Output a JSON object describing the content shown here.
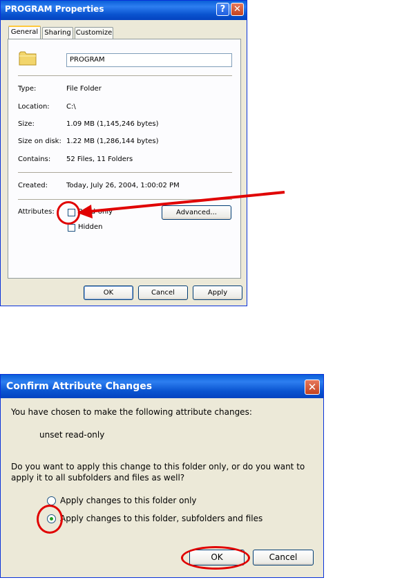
{
  "properties_dialog": {
    "title": "PROGRAM Properties",
    "help_button": "?",
    "close_button": "✕",
    "tabs": [
      "General",
      "Sharing",
      "Customize"
    ],
    "name_value": "PROGRAM",
    "fields": [
      {
        "label": "Type:",
        "value": "File Folder"
      },
      {
        "label": "Location:",
        "value": "C:\\"
      },
      {
        "label": "Size:",
        "value": "1.09 MB (1,145,246 bytes)"
      },
      {
        "label": "Size on disk:",
        "value": "1.22 MB (1,286,144 bytes)"
      },
      {
        "label": "Contains:",
        "value": "52 Files, 11 Folders"
      }
    ],
    "created_label": "Created:",
    "created_value": "Today, July 26, 2004, 1:00:02 PM",
    "attributes_label": "Attributes:",
    "readonly_label": "Read-only",
    "hidden_label": "Hidden",
    "advanced_button": "Advanced...",
    "ok_button": "OK",
    "cancel_button": "Cancel",
    "apply_button": "Apply"
  },
  "confirm_dialog": {
    "title": "Confirm Attribute Changes",
    "close_button": "✕",
    "intro": "You have chosen to make the following attribute changes:",
    "change": "unset read-only",
    "question_line1": "Do you want to apply this change to this folder only, or do you want to",
    "question_line2": "apply it to all subfolders and files as well?",
    "option_folder_only": "Apply changes to this folder only",
    "option_all": "Apply changes to this folder, subfolders and files",
    "selected_option": "option_all",
    "ok_button": "OK",
    "cancel_button": "Cancel"
  },
  "annotation_color": "#e00000"
}
